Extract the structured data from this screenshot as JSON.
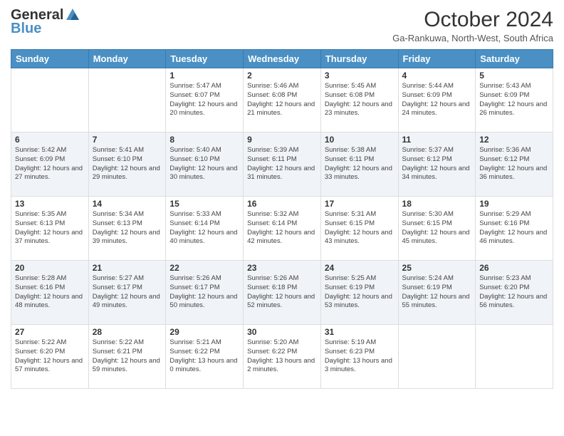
{
  "logo": {
    "general": "General",
    "blue": "Blue"
  },
  "header": {
    "month": "October 2024",
    "location": "Ga-Rankuwa, North-West, South Africa"
  },
  "days_of_week": [
    "Sunday",
    "Monday",
    "Tuesday",
    "Wednesday",
    "Thursday",
    "Friday",
    "Saturday"
  ],
  "weeks": [
    [
      {
        "day": "",
        "info": ""
      },
      {
        "day": "",
        "info": ""
      },
      {
        "day": "1",
        "info": "Sunrise: 5:47 AM\nSunset: 6:07 PM\nDaylight: 12 hours and 20 minutes."
      },
      {
        "day": "2",
        "info": "Sunrise: 5:46 AM\nSunset: 6:08 PM\nDaylight: 12 hours and 21 minutes."
      },
      {
        "day": "3",
        "info": "Sunrise: 5:45 AM\nSunset: 6:08 PM\nDaylight: 12 hours and 23 minutes."
      },
      {
        "day": "4",
        "info": "Sunrise: 5:44 AM\nSunset: 6:09 PM\nDaylight: 12 hours and 24 minutes."
      },
      {
        "day": "5",
        "info": "Sunrise: 5:43 AM\nSunset: 6:09 PM\nDaylight: 12 hours and 26 minutes."
      }
    ],
    [
      {
        "day": "6",
        "info": "Sunrise: 5:42 AM\nSunset: 6:09 PM\nDaylight: 12 hours and 27 minutes."
      },
      {
        "day": "7",
        "info": "Sunrise: 5:41 AM\nSunset: 6:10 PM\nDaylight: 12 hours and 29 minutes."
      },
      {
        "day": "8",
        "info": "Sunrise: 5:40 AM\nSunset: 6:10 PM\nDaylight: 12 hours and 30 minutes."
      },
      {
        "day": "9",
        "info": "Sunrise: 5:39 AM\nSunset: 6:11 PM\nDaylight: 12 hours and 31 minutes."
      },
      {
        "day": "10",
        "info": "Sunrise: 5:38 AM\nSunset: 6:11 PM\nDaylight: 12 hours and 33 minutes."
      },
      {
        "day": "11",
        "info": "Sunrise: 5:37 AM\nSunset: 6:12 PM\nDaylight: 12 hours and 34 minutes."
      },
      {
        "day": "12",
        "info": "Sunrise: 5:36 AM\nSunset: 6:12 PM\nDaylight: 12 hours and 36 minutes."
      }
    ],
    [
      {
        "day": "13",
        "info": "Sunrise: 5:35 AM\nSunset: 6:13 PM\nDaylight: 12 hours and 37 minutes."
      },
      {
        "day": "14",
        "info": "Sunrise: 5:34 AM\nSunset: 6:13 PM\nDaylight: 12 hours and 39 minutes."
      },
      {
        "day": "15",
        "info": "Sunrise: 5:33 AM\nSunset: 6:14 PM\nDaylight: 12 hours and 40 minutes."
      },
      {
        "day": "16",
        "info": "Sunrise: 5:32 AM\nSunset: 6:14 PM\nDaylight: 12 hours and 42 minutes."
      },
      {
        "day": "17",
        "info": "Sunrise: 5:31 AM\nSunset: 6:15 PM\nDaylight: 12 hours and 43 minutes."
      },
      {
        "day": "18",
        "info": "Sunrise: 5:30 AM\nSunset: 6:15 PM\nDaylight: 12 hours and 45 minutes."
      },
      {
        "day": "19",
        "info": "Sunrise: 5:29 AM\nSunset: 6:16 PM\nDaylight: 12 hours and 46 minutes."
      }
    ],
    [
      {
        "day": "20",
        "info": "Sunrise: 5:28 AM\nSunset: 6:16 PM\nDaylight: 12 hours and 48 minutes."
      },
      {
        "day": "21",
        "info": "Sunrise: 5:27 AM\nSunset: 6:17 PM\nDaylight: 12 hours and 49 minutes."
      },
      {
        "day": "22",
        "info": "Sunrise: 5:26 AM\nSunset: 6:17 PM\nDaylight: 12 hours and 50 minutes."
      },
      {
        "day": "23",
        "info": "Sunrise: 5:26 AM\nSunset: 6:18 PM\nDaylight: 12 hours and 52 minutes."
      },
      {
        "day": "24",
        "info": "Sunrise: 5:25 AM\nSunset: 6:19 PM\nDaylight: 12 hours and 53 minutes."
      },
      {
        "day": "25",
        "info": "Sunrise: 5:24 AM\nSunset: 6:19 PM\nDaylight: 12 hours and 55 minutes."
      },
      {
        "day": "26",
        "info": "Sunrise: 5:23 AM\nSunset: 6:20 PM\nDaylight: 12 hours and 56 minutes."
      }
    ],
    [
      {
        "day": "27",
        "info": "Sunrise: 5:22 AM\nSunset: 6:20 PM\nDaylight: 12 hours and 57 minutes."
      },
      {
        "day": "28",
        "info": "Sunrise: 5:22 AM\nSunset: 6:21 PM\nDaylight: 12 hours and 59 minutes."
      },
      {
        "day": "29",
        "info": "Sunrise: 5:21 AM\nSunset: 6:22 PM\nDaylight: 13 hours and 0 minutes."
      },
      {
        "day": "30",
        "info": "Sunrise: 5:20 AM\nSunset: 6:22 PM\nDaylight: 13 hours and 2 minutes."
      },
      {
        "day": "31",
        "info": "Sunrise: 5:19 AM\nSunset: 6:23 PM\nDaylight: 13 hours and 3 minutes."
      },
      {
        "day": "",
        "info": ""
      },
      {
        "day": "",
        "info": ""
      }
    ]
  ]
}
